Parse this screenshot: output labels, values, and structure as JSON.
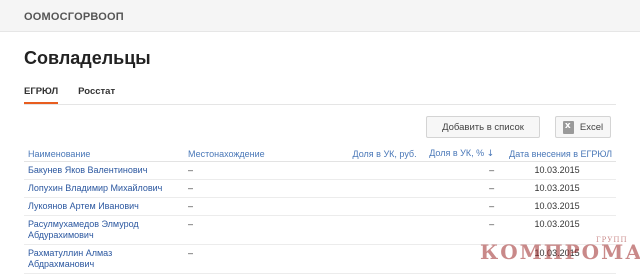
{
  "header": {
    "company": "ООМОСГОРВООП"
  },
  "page": {
    "title": "Совладельцы"
  },
  "tabs": [
    {
      "label": "ЕГРЮЛ",
      "active": true
    },
    {
      "label": "Росстат",
      "active": false
    }
  ],
  "toolbar": {
    "add_label": "Добавить в список",
    "excel_label": "Excel"
  },
  "table": {
    "headers": {
      "name": "Наименование",
      "location": "Местонахождение",
      "share_rub": "Доля в УК, руб.",
      "share_pct": "Доля в УК, %",
      "sort_arrow": "↓",
      "date": "Дата внесения в ЕГРЮЛ"
    },
    "rows": [
      {
        "name": "Бакунев Яков Валентинович",
        "location": "–",
        "share_rub": "",
        "share_pct": "–",
        "date": "10.03.2015"
      },
      {
        "name": "Лопухин Владимир Михайлович",
        "location": "–",
        "share_rub": "",
        "share_pct": "–",
        "date": "10.03.2015"
      },
      {
        "name": "Лукоянов Артем Иванович",
        "location": "–",
        "share_rub": "",
        "share_pct": "–",
        "date": "10.03.2015"
      },
      {
        "name": "Расулмухамедов Элмурод Абдурахимович",
        "location": "–",
        "share_rub": "",
        "share_pct": "–",
        "date": "10.03.2015"
      },
      {
        "name": "Рахматуллин Алмаз Абдрахманович",
        "location": "–",
        "share_rub": "",
        "share_pct": "",
        "date": "10.03.2015"
      }
    ]
  },
  "watermark": {
    "main": "КОМПРОМАТ",
    "sub": "ГРУПП"
  },
  "colors": {
    "accent": "#e85d1f",
    "link": "#2c58a0",
    "header_link": "#4a78b8",
    "watermark": "#9e2a2a"
  }
}
